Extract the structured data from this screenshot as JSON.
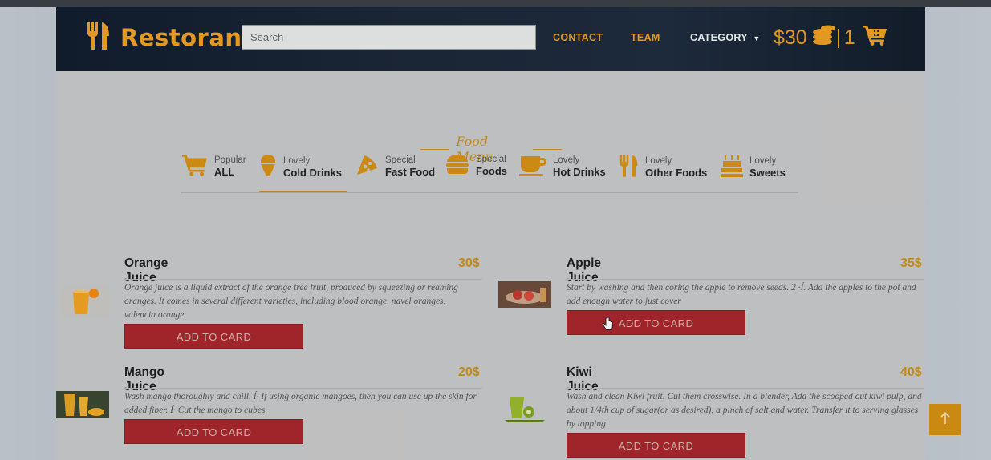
{
  "brand": {
    "name": "Restoran",
    "color": "#f0a020"
  },
  "search": {
    "placeholder": "Search"
  },
  "nav": {
    "contact": "CONTACT",
    "team": "TEAM",
    "category": "CATEGORY"
  },
  "cart": {
    "balance": "$30",
    "count": "1"
  },
  "menu": {
    "title": "Food Menu",
    "tabs": [
      {
        "sub": "Popular",
        "main": "ALL",
        "icon": "cart-icon"
      },
      {
        "sub": "Lovely",
        "main": "Cold Drinks",
        "icon": "ice-cream-icon",
        "active": true
      },
      {
        "sub": "Special",
        "main": "Fast Food",
        "icon": "pizza-icon"
      },
      {
        "sub": "Special",
        "main": "Foods",
        "icon": "burger-icon"
      },
      {
        "sub": "Lovely",
        "main": "Hot Drinks",
        "icon": "coffee-icon"
      },
      {
        "sub": "Lovely",
        "main": "Other Foods",
        "icon": "utensils-icon"
      },
      {
        "sub": "Lovely",
        "main": "Sweets",
        "icon": "cake-icon"
      }
    ]
  },
  "items": [
    {
      "title": "Orange Juice",
      "price": "30$",
      "desc": "Orange juice is a liquid extract of the orange tree fruit, produced by squeezing or reaming oranges. It comes in several different varieties, including blood orange, navel oranges, valencia orange",
      "button": "ADD TO CARD"
    },
    {
      "title": "Apple Juice",
      "price": "35$",
      "desc": "Start by washing and then coring the apple to remove seeds. 2 ·Í. Add the apples to the pot and add enough water to just cover",
      "button": "ADD TO CARD"
    },
    {
      "title": "Mango Juice",
      "price": "20$",
      "desc": "Wash mango thoroughly and chill. Í· If using organic mangoes, then you can use up the skin for added fiber. Í· Cut the mango to cubes",
      "button": "ADD TO CARD"
    },
    {
      "title": "Kiwi Juice",
      "price": "40$",
      "desc": "Wash and clean Kiwi fruit. Cut them crosswise. In a blender, Add the scooped out kiwi pulp, and about 1/4th cup of sugar(or as desired), a pinch of salt and water. Transfer it to serving glasses by topping",
      "button": "ADD TO CARD"
    }
  ],
  "scroll_top": {
    "icon": "arrow-up-icon"
  },
  "colors": {
    "accent": "#f0a020",
    "button": "#a8252a",
    "navbar": "#152032"
  }
}
